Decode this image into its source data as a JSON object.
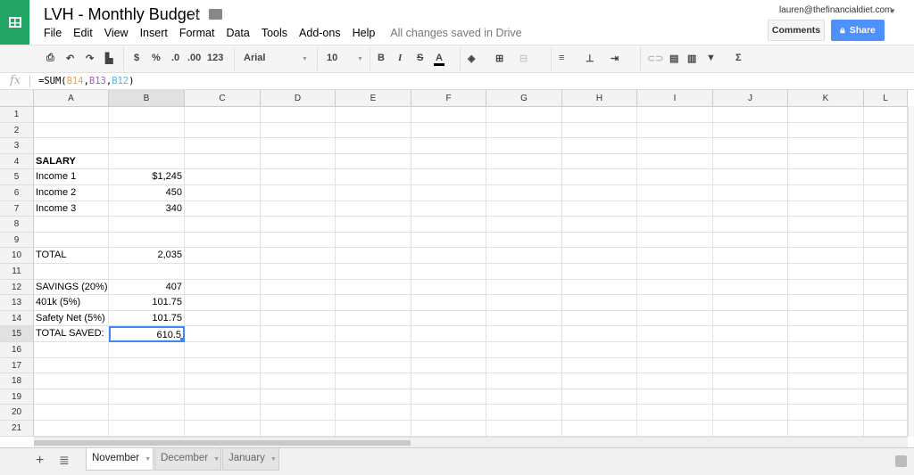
{
  "app": {
    "title": "LVH - Monthly Budget",
    "status": "All changes saved in Drive",
    "user": "lauren@thefinancialdiet.com",
    "comments_label": "Comments",
    "share_label": "Share"
  },
  "menu": [
    "File",
    "Edit",
    "View",
    "Insert",
    "Format",
    "Data",
    "Tools",
    "Add-ons",
    "Help"
  ],
  "toolbar": {
    "currency": "$",
    "percent": "%",
    "dec_less": ".0",
    "dec_more": ".00",
    "more_formats": "123",
    "font": "Arial",
    "font_size": "10",
    "bold": "B",
    "italic": "I",
    "strike": "S",
    "text_color": "A",
    "sum": "Σ"
  },
  "formula_bar": {
    "fx": "fx",
    "formula": "=SUM(B14,B13,B12)",
    "ref_colors": [
      "#f6a04d",
      "#a259c4",
      "#52b6e0"
    ]
  },
  "columns": [
    "A",
    "B",
    "C",
    "D",
    "E",
    "F",
    "G",
    "H",
    "I",
    "J",
    "K",
    "L"
  ],
  "rows": [
    "1",
    "2",
    "3",
    "4",
    "5",
    "6",
    "7",
    "8",
    "9",
    "10",
    "11",
    "12",
    "13",
    "14",
    "15",
    "16",
    "17",
    "18",
    "19",
    "20",
    "21"
  ],
  "selected_cell": "B15",
  "cells": [
    {
      "r": 4,
      "a": "SALARY",
      "b": "",
      "bold": true
    },
    {
      "r": 5,
      "a": "Income 1",
      "b": "$1,245"
    },
    {
      "r": 6,
      "a": "Income 2",
      "b": "450"
    },
    {
      "r": 7,
      "a": "Income 3",
      "b": "340"
    },
    {
      "r": 10,
      "a": "TOTAL",
      "b": "2,035"
    },
    {
      "r": 12,
      "a": "SAVINGS (20%)",
      "b": "407"
    },
    {
      "r": 13,
      "a": "401k (5%)",
      "b": "101.75"
    },
    {
      "r": 14,
      "a": "Safety Net (5%)",
      "b": "101.75"
    },
    {
      "r": 15,
      "a": "TOTAL SAVED:",
      "b": "610.5"
    }
  ],
  "sheets": [
    {
      "label": "November",
      "active": true
    },
    {
      "label": "December"
    },
    {
      "label": "January"
    }
  ],
  "colors": {
    "brand": "#21a464",
    "share": "#4d90fe",
    "selection": "#4285f4"
  }
}
